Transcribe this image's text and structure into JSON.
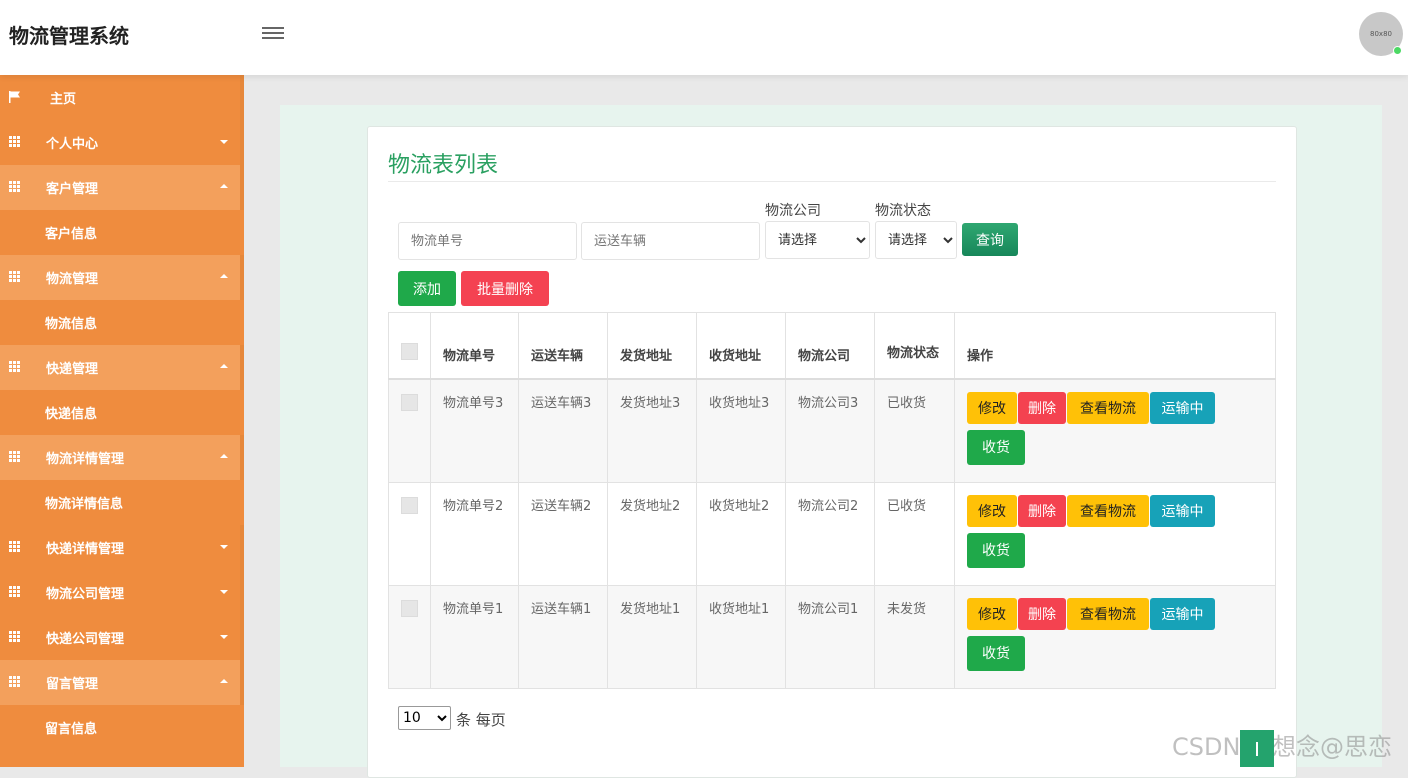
{
  "header": {
    "title": "物流管理系统",
    "avatar_text": "80x80"
  },
  "sidebar": {
    "items": [
      {
        "label": "主页",
        "icon": "flag-icon",
        "caret": ""
      },
      {
        "label": "个人中心",
        "icon": "grid-icon",
        "caret": "down"
      },
      {
        "label": "客户管理",
        "icon": "grid-icon",
        "caret": "up"
      },
      {
        "label": "客户信息",
        "sub": true
      },
      {
        "label": "物流管理",
        "icon": "grid-icon",
        "caret": "up"
      },
      {
        "label": "物流信息",
        "sub": true
      },
      {
        "label": "快递管理",
        "icon": "grid-icon",
        "caret": "up"
      },
      {
        "label": "快递信息",
        "sub": true
      },
      {
        "label": "物流详情管理",
        "icon": "grid-icon",
        "caret": "up"
      },
      {
        "label": "物流详情信息",
        "sub": true
      },
      {
        "label": "快递详情管理",
        "icon": "grid-icon",
        "caret": "down"
      },
      {
        "label": "物流公司管理",
        "icon": "grid-icon",
        "caret": "down"
      },
      {
        "label": "快递公司管理",
        "icon": "grid-icon",
        "caret": "down"
      },
      {
        "label": "留言管理",
        "icon": "grid-icon",
        "caret": "up"
      },
      {
        "label": "留言信息",
        "sub": true
      }
    ]
  },
  "main": {
    "title": "物流表列表",
    "search": {
      "order_placeholder": "物流单号",
      "vehicle_placeholder": "运送车辆",
      "company_label": "物流公司",
      "company_value": "请选择",
      "status_label": "物流状态",
      "status_value": "请选择",
      "query_button": "查询"
    },
    "actions": {
      "add": "添加",
      "batch_delete": "批量删除"
    },
    "table": {
      "headers": [
        "物流单号",
        "运送车辆",
        "发货地址",
        "收货地址",
        "物流公司",
        "物流状态",
        "操作"
      ],
      "rows": [
        {
          "order": "物流单号3",
          "vehicle": "运送车辆3",
          "from": "发货地址3",
          "to": "收货地址3",
          "company": "物流公司3",
          "status": "已收货"
        },
        {
          "order": "物流单号2",
          "vehicle": "运送车辆2",
          "from": "发货地址2",
          "to": "收货地址2",
          "company": "物流公司2",
          "status": "已收货"
        },
        {
          "order": "物流单号1",
          "vehicle": "运送车辆1",
          "from": "发货地址1",
          "to": "收货地址1",
          "company": "物流公司1",
          "status": "未发货"
        }
      ],
      "row_buttons": {
        "edit": "修改",
        "delete": "删除",
        "view": "查看物流",
        "transit": "运输中",
        "receive": "收货"
      }
    },
    "pager": {
      "page_size": "10",
      "per_page_text": "条 每页"
    }
  },
  "watermark": "CSDN @想念@思恋",
  "colors": {
    "sidebar": "#ef8c3e",
    "title_green": "#2aa061",
    "edit": "#ffc107",
    "delete": "#f44252",
    "transit": "#17a2b8",
    "receive": "#1fa94a"
  }
}
